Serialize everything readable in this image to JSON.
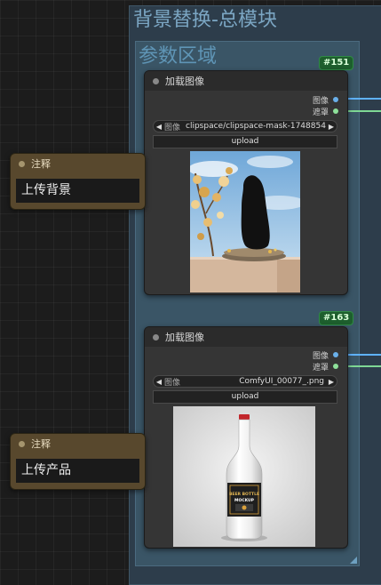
{
  "group": {
    "title": "背景替换-总模块",
    "inner_title": "参数区域"
  },
  "nodes": [
    {
      "id": "#151",
      "title": "加载图像",
      "outputs": [
        "图像",
        "遮罩"
      ],
      "image_widget": {
        "label": "图像",
        "value": "clipspace/clipspace-mask-1748854..."
      },
      "upload_label": "upload",
      "preview_icon": "podium-scene-with-dark-masked-area"
    },
    {
      "id": "#163",
      "title": "加载图像",
      "outputs": [
        "图像",
        "遮罩"
      ],
      "image_widget": {
        "label": "图像",
        "value": "ComfyUI_00077_.png"
      },
      "upload_label": "upload",
      "preview_icon": "beer-bottle-mockup",
      "bottle_label": [
        "BEER BOTTLE",
        "MOCKUP"
      ]
    }
  ],
  "notes": [
    {
      "title": "注释",
      "text": "上传背景"
    },
    {
      "title": "注释",
      "text": "上传产品"
    }
  ],
  "colors": {
    "group_outer": "#2d3d4b",
    "group_inner": "#3a5566",
    "node_bg": "#353535",
    "note_bg": "#58482d",
    "badge": "#1d5e2d",
    "image_port": "#6ab0ea",
    "mask_port": "#8ee09a"
  }
}
